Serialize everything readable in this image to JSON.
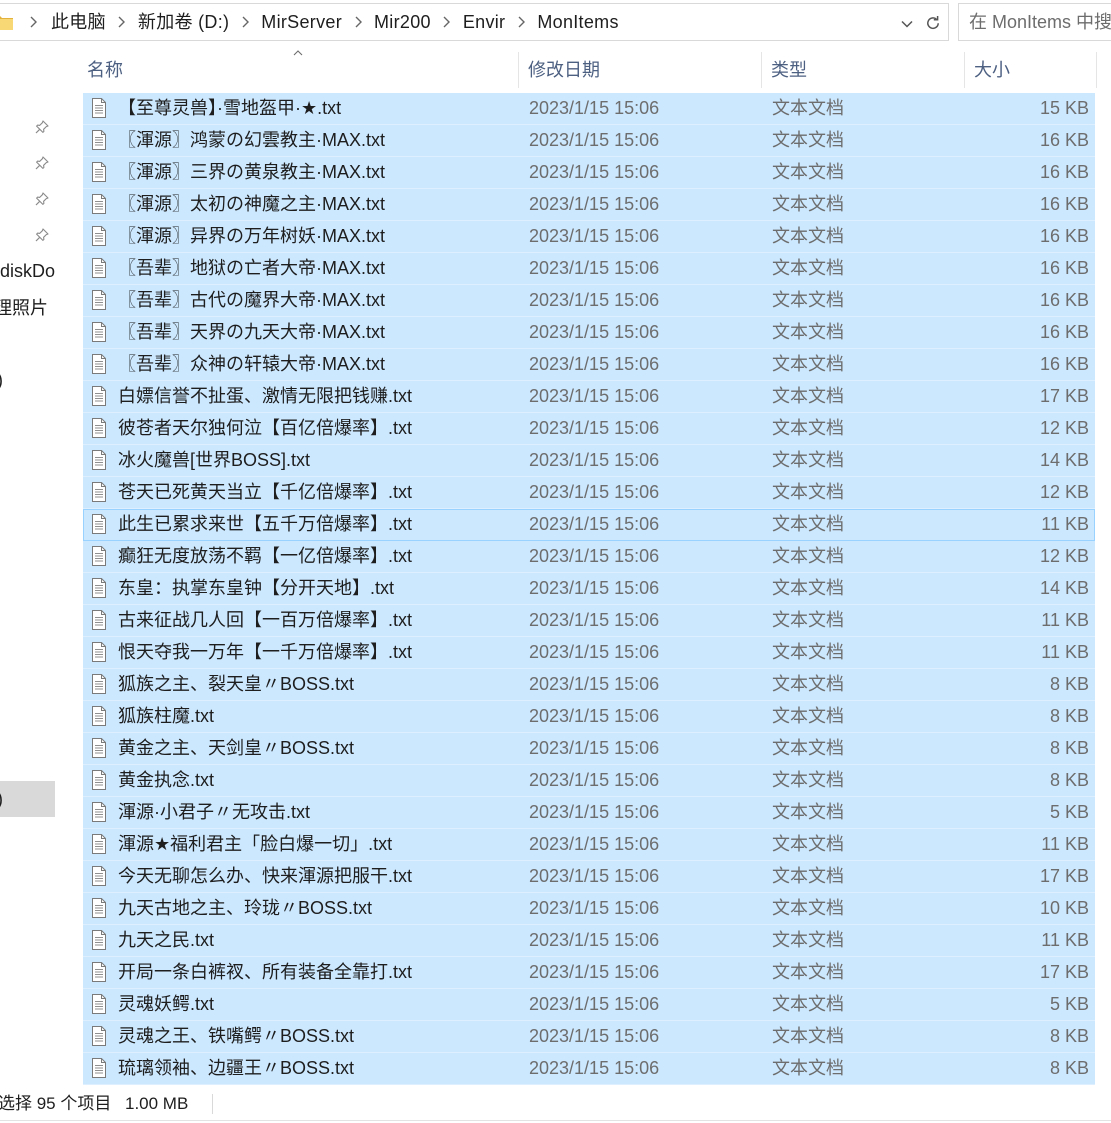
{
  "address_bar": {
    "folder_icon": "folder-icon",
    "crumbs": [
      "此电脑",
      "新加卷 (D:)",
      "MirServer",
      "Mir200",
      "Envir",
      "MonItems"
    ],
    "dropdown_icon": "chevron-down-icon",
    "refresh_icon": "refresh-icon",
    "search_placeholder": "在 MonItems 中搜"
  },
  "nav_pane": {
    "items": [
      {
        "icon": "pin-icon"
      },
      {
        "icon": "pin-icon"
      },
      {
        "icon": "pin-icon"
      },
      {
        "icon": "pin-icon"
      },
      {
        "label": "diskDo"
      },
      {
        "label": "理照片"
      },
      {
        "label": ")"
      },
      {
        "label": ")",
        "selected": true
      }
    ]
  },
  "columns": [
    {
      "label": "名称",
      "sort_icon": "chevron-up-icon"
    },
    {
      "label": "修改日期"
    },
    {
      "label": "类型"
    },
    {
      "label": "大小"
    }
  ],
  "files": {
    "all_selected": true,
    "file_icon": "text-file-icon",
    "items": [
      {
        "name": "【至尊灵兽】·雪地盔甲·★.txt",
        "modified": "2023/1/15 15:06",
        "type": "文本文档",
        "size": "15 KB"
      },
      {
        "name": "〖渾源〗鸿蒙の幻雲教主·MAX.txt",
        "modified": "2023/1/15 15:06",
        "type": "文本文档",
        "size": "16 KB"
      },
      {
        "name": "〖渾源〗三界の黄泉教主·MAX.txt",
        "modified": "2023/1/15 15:06",
        "type": "文本文档",
        "size": "16 KB"
      },
      {
        "name": "〖渾源〗太初の神魔之主·MAX.txt",
        "modified": "2023/1/15 15:06",
        "type": "文本文档",
        "size": "16 KB"
      },
      {
        "name": "〖渾源〗异界の万年树妖·MAX.txt",
        "modified": "2023/1/15 15:06",
        "type": "文本文档",
        "size": "16 KB"
      },
      {
        "name": "〖吾辈〗地狱の亡者大帝·MAX.txt",
        "modified": "2023/1/15 15:06",
        "type": "文本文档",
        "size": "16 KB"
      },
      {
        "name": "〖吾辈〗古代の魔界大帝·MAX.txt",
        "modified": "2023/1/15 15:06",
        "type": "文本文档",
        "size": "16 KB"
      },
      {
        "name": "〖吾辈〗天界の九天大帝·MAX.txt",
        "modified": "2023/1/15 15:06",
        "type": "文本文档",
        "size": "16 KB"
      },
      {
        "name": "〖吾辈〗众神の轩辕大帝·MAX.txt",
        "modified": "2023/1/15 15:06",
        "type": "文本文档",
        "size": "16 KB"
      },
      {
        "name": "白嫖信誉不扯蛋、激情无限把钱赚.txt",
        "modified": "2023/1/15 15:06",
        "type": "文本文档",
        "size": "17 KB"
      },
      {
        "name": "彼苍者天尔独何泣【百亿倍爆率】.txt",
        "modified": "2023/1/15 15:06",
        "type": "文本文档",
        "size": "12 KB"
      },
      {
        "name": "冰火魔兽[世界BOSS].txt",
        "modified": "2023/1/15 15:06",
        "type": "文本文档",
        "size": "14 KB"
      },
      {
        "name": "苍天已死黄天当立【千亿倍爆率】.txt",
        "modified": "2023/1/15 15:06",
        "type": "文本文档",
        "size": "12 KB"
      },
      {
        "name": "此生已累求来世【五千万倍爆率】.txt",
        "modified": "2023/1/15 15:06",
        "type": "文本文档",
        "size": "11 KB",
        "focused": true
      },
      {
        "name": "癫狂无度放荡不羁【一亿倍爆率】.txt",
        "modified": "2023/1/15 15:06",
        "type": "文本文档",
        "size": "12 KB"
      },
      {
        "name": "东皇：执掌东皇钟【分开天地】.txt",
        "modified": "2023/1/15 15:06",
        "type": "文本文档",
        "size": "14 KB"
      },
      {
        "name": "古来征战几人回【一百万倍爆率】.txt",
        "modified": "2023/1/15 15:06",
        "type": "文本文档",
        "size": "11 KB"
      },
      {
        "name": "恨天夺我一万年【一千万倍爆率】.txt",
        "modified": "2023/1/15 15:06",
        "type": "文本文档",
        "size": "11 KB"
      },
      {
        "name": "狐族之主、裂天皇〃BOSS.txt",
        "modified": "2023/1/15 15:06",
        "type": "文本文档",
        "size": "8 KB"
      },
      {
        "name": "狐族柱魔.txt",
        "modified": "2023/1/15 15:06",
        "type": "文本文档",
        "size": "8 KB"
      },
      {
        "name": "黄金之主、天剑皇〃BOSS.txt",
        "modified": "2023/1/15 15:06",
        "type": "文本文档",
        "size": "8 KB"
      },
      {
        "name": "黄金执念.txt",
        "modified": "2023/1/15 15:06",
        "type": "文本文档",
        "size": "8 KB"
      },
      {
        "name": "渾源·小君子〃无攻击.txt",
        "modified": "2023/1/15 15:06",
        "type": "文本文档",
        "size": "5 KB"
      },
      {
        "name": "渾源★福利君主「脸白爆一切」.txt",
        "modified": "2023/1/15 15:06",
        "type": "文本文档",
        "size": "11 KB"
      },
      {
        "name": "今天无聊怎么办、快来渾源把服干.txt",
        "modified": "2023/1/15 15:06",
        "type": "文本文档",
        "size": "17 KB"
      },
      {
        "name": "九天古地之主、玲珑〃BOSS.txt",
        "modified": "2023/1/15 15:06",
        "type": "文本文档",
        "size": "10 KB"
      },
      {
        "name": "九天之民.txt",
        "modified": "2023/1/15 15:06",
        "type": "文本文档",
        "size": "11 KB"
      },
      {
        "name": "开局一条白裤衩、所有装备全靠打.txt",
        "modified": "2023/1/15 15:06",
        "type": "文本文档",
        "size": "17 KB"
      },
      {
        "name": "灵魂妖鳄.txt",
        "modified": "2023/1/15 15:06",
        "type": "文本文档",
        "size": "5 KB"
      },
      {
        "name": "灵魂之王、铁嘴鳄〃BOSS.txt",
        "modified": "2023/1/15 15:06",
        "type": "文本文档",
        "size": "8 KB"
      },
      {
        "name": "琉璃领袖、边疆王〃BOSS.txt",
        "modified": "2023/1/15 15:06",
        "type": "文本文档",
        "size": "8 KB"
      }
    ]
  },
  "status_bar": {
    "selection": "选择 95 个项目",
    "size": "1.00 MB"
  },
  "colors": {
    "selection_bg": "#cce8ff",
    "selection_border": "#99d1ff",
    "header_text": "#4d6082",
    "meta_text": "#6d6d6d",
    "nav_selected_bg": "#d9d9d9"
  }
}
